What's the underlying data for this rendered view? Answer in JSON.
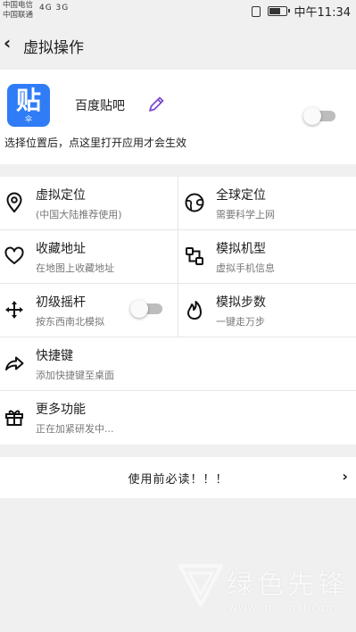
{
  "status_bar": {
    "carrier1": "中国电信",
    "carrier2": "中国联通",
    "network": "4G  3G",
    "time": "中午11:34"
  },
  "header": {
    "back_icon": "chevron-left-icon",
    "title": "虚拟操作"
  },
  "app": {
    "icon_text": "贴",
    "icon_sub": "伞",
    "name": "百度贴吧",
    "edit_icon": "pencil-icon",
    "toggle_on": false,
    "hint": "选择位置后，点这里打开应用才会生效",
    "icon_color": "#2f7cf6"
  },
  "features": [
    {
      "icon": "location-pin-icon",
      "title": "虚拟定位",
      "subtitle": "(中国大陆推荐使用)"
    },
    {
      "icon": "globe-icon",
      "title": "全球定位",
      "subtitle": "需要科学上网"
    },
    {
      "icon": "heart-icon",
      "title": "收藏地址",
      "subtitle": "在地图上收藏地址"
    },
    {
      "icon": "device-model-icon",
      "title": "模拟机型",
      "subtitle": "虚拟手机信息"
    },
    {
      "icon": "joystick-arrows-icon",
      "title": "初级摇杆",
      "subtitle": "按东西南北模拟",
      "toggle_on": false
    },
    {
      "icon": "flame-icon",
      "title": "模拟步数",
      "subtitle": "一键走万步"
    }
  ],
  "rows": [
    {
      "icon": "share-arrow-icon",
      "title": "快捷键",
      "subtitle": "添加快捷键至桌面"
    },
    {
      "icon": "gift-icon",
      "title": "更多功能",
      "subtitle": "正在加紧研发中..."
    }
  ],
  "notice": {
    "label": "使用前必读！！！",
    "icon": "chevron-right-icon"
  },
  "watermark": {
    "text": "绿色先锋",
    "url": "www.greenxf.com"
  }
}
